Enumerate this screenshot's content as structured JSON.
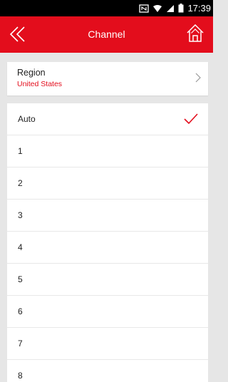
{
  "status_bar": {
    "time": "17:39",
    "icons": [
      "nfc-icon",
      "wifi-icon",
      "signal-icon",
      "battery-icon"
    ]
  },
  "app_bar": {
    "title": "Channel",
    "back_icon": "double-chevron-left-icon",
    "home_icon": "home-icon",
    "color": "#e30d1c"
  },
  "region": {
    "label": "Region",
    "value": "United States"
  },
  "channels": {
    "selected": "Auto",
    "items": [
      "Auto",
      "1",
      "2",
      "3",
      "4",
      "5",
      "6",
      "7",
      "8"
    ]
  }
}
